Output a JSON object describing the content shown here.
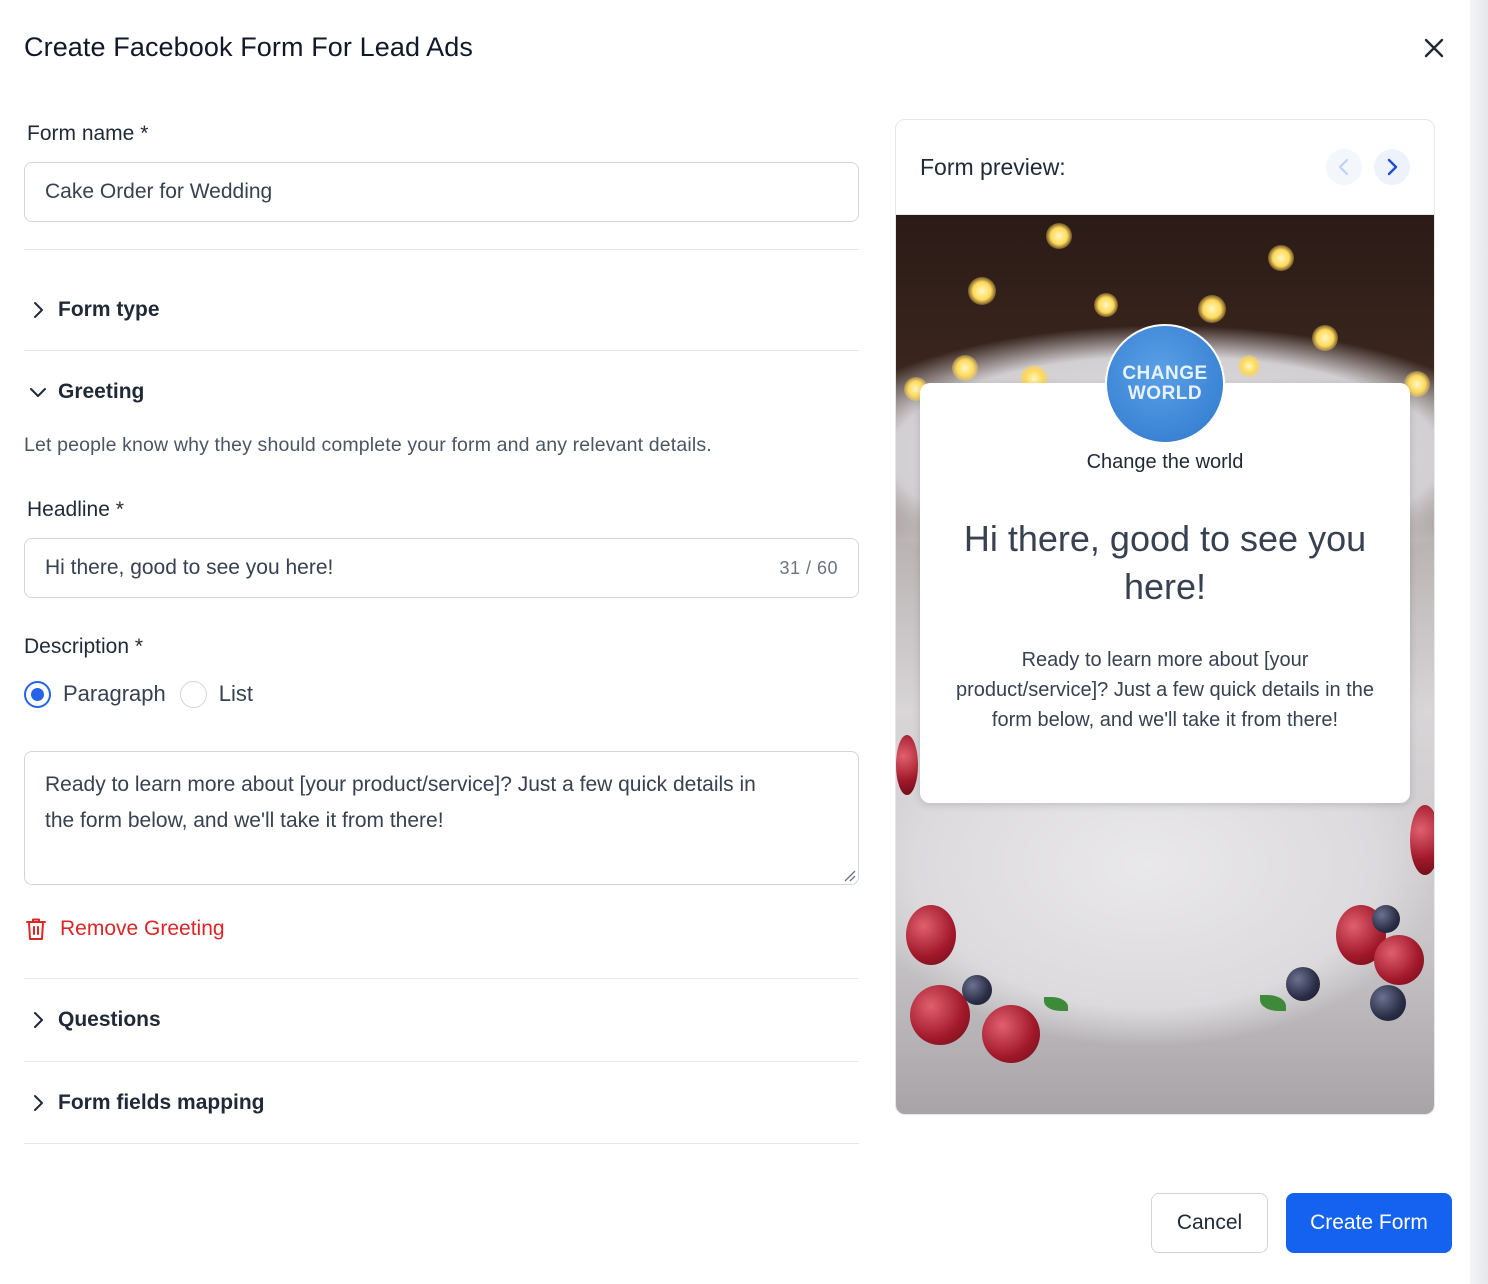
{
  "modal": {
    "title": "Create Facebook Form For Lead Ads"
  },
  "form": {
    "name_label": "Form name *",
    "name_value": "Cake Order for Wedding",
    "sections": {
      "form_type": "Form type",
      "greeting": "Greeting",
      "questions": "Questions",
      "mapping": "Form fields mapping"
    },
    "greeting": {
      "help": "Let people know why they should complete your form and any relevant details.",
      "headline_label": "Headline *",
      "headline_value": "Hi there, good to see you here!",
      "headline_counter": "31 / 60",
      "description_label": "Description *",
      "options": [
        "Paragraph",
        "List"
      ],
      "selected_option": "Paragraph",
      "description_value": "Ready to learn more about [your product/service]? Just a few quick details in the form below, and we'll take it from there!",
      "remove_label": "Remove Greeting"
    }
  },
  "preview": {
    "title": "Form preview:",
    "logo_line1": "CHANGE",
    "logo_line2": "WORLD",
    "brand": "Change the world",
    "headline": "Hi there, good to see you here!",
    "description": "Ready to learn more about [your product/service]? Just a few quick details in the form below, and we'll take it from there!"
  },
  "footer": {
    "cancel": "Cancel",
    "create": "Create Form"
  },
  "colors": {
    "primary": "#1662f0",
    "danger": "#dc2626",
    "border": "#d1d5db"
  },
  "icons": [
    "close-icon",
    "chevron-right-icon",
    "chevron-down-icon",
    "trash-icon",
    "chevron-left-icon"
  ]
}
